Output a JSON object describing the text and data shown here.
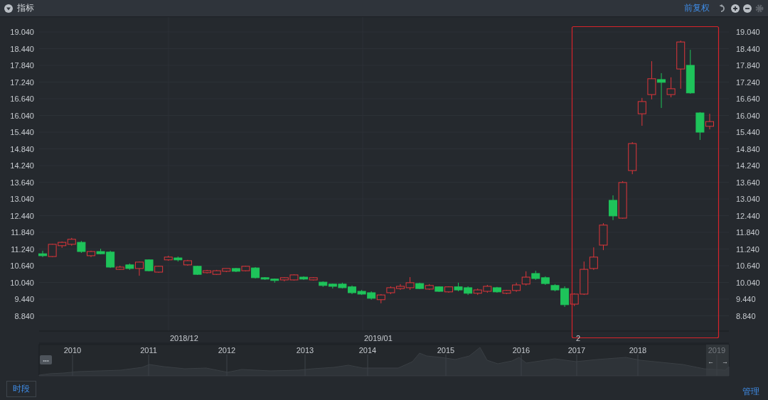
{
  "header": {
    "title": "指标",
    "adjust_link": "前复权"
  },
  "chart": {
    "right_ticks": [
      "19.040",
      "18.440",
      "17.840",
      "17.240",
      "16.640",
      "16.040",
      "15.440",
      "14.840",
      "14.240",
      "13.640",
      "13.040",
      "12.440",
      "11.840",
      "11.240",
      "10.640",
      "10.040",
      "9.440",
      "8.840"
    ],
    "x_labels": [
      "2018/12",
      "2019/01",
      "2"
    ],
    "chart_data": {
      "type": "candlestick",
      "grid": true,
      "ylim": [
        8.29,
        19.6
      ],
      "yticks": [
        {
          "value": 19.04,
          "label": "19.040"
        },
        {
          "value": 18.44,
          "label": "18.440"
        },
        {
          "value": 17.84,
          "label": "17.840"
        },
        {
          "value": 17.24,
          "label": "17.240"
        },
        {
          "value": 16.64,
          "label": "16.640"
        },
        {
          "value": 16.04,
          "label": "16.040"
        },
        {
          "value": 15.44,
          "label": "15.440"
        },
        {
          "value": 14.84,
          "label": "14.840"
        },
        {
          "value": 14.24,
          "label": "14.240"
        },
        {
          "value": 13.64,
          "label": "13.640"
        },
        {
          "value": 13.04,
          "label": "13.040"
        },
        {
          "value": 12.44,
          "label": "12.440"
        },
        {
          "value": 11.84,
          "label": "11.840"
        },
        {
          "value": 11.24,
          "label": "11.240"
        },
        {
          "value": 10.64,
          "label": "10.640"
        },
        {
          "value": 10.04,
          "label": "10.040"
        },
        {
          "value": 9.44,
          "label": "9.440"
        },
        {
          "value": 8.84,
          "label": "8.840"
        }
      ],
      "ohlc": [
        [
          11.07,
          11.18,
          10.95,
          11.0
        ],
        [
          10.97,
          11.43,
          10.95,
          11.41
        ],
        [
          11.36,
          11.51,
          11.28,
          11.48
        ],
        [
          11.41,
          11.64,
          11.36,
          11.59
        ],
        [
          11.48,
          11.53,
          11.1,
          11.15
        ],
        [
          11.0,
          11.18,
          10.95,
          11.15
        ],
        [
          11.15,
          11.25,
          11.05,
          11.07
        ],
        [
          11.13,
          11.18,
          10.56,
          10.59
        ],
        [
          10.51,
          10.64,
          10.49,
          10.59
        ],
        [
          10.67,
          10.72,
          10.49,
          10.54
        ],
        [
          10.54,
          10.79,
          10.28,
          10.77
        ],
        [
          10.85,
          10.87,
          10.44,
          10.46
        ],
        [
          10.41,
          10.64,
          10.39,
          10.62
        ],
        [
          10.85,
          11.0,
          10.82,
          10.95
        ],
        [
          10.92,
          10.97,
          10.79,
          10.85
        ],
        [
          10.67,
          10.85,
          10.64,
          10.82
        ],
        [
          10.62,
          10.64,
          10.31,
          10.33
        ],
        [
          10.39,
          10.49,
          10.36,
          10.46
        ],
        [
          10.33,
          10.49,
          10.31,
          10.46
        ],
        [
          10.44,
          10.54,
          10.41,
          10.54
        ],
        [
          10.54,
          10.56,
          10.41,
          10.44
        ],
        [
          10.46,
          10.64,
          10.44,
          10.62
        ],
        [
          10.56,
          10.59,
          10.18,
          10.21
        ],
        [
          10.21,
          10.23,
          10.13,
          10.16
        ],
        [
          10.16,
          10.18,
          10.03,
          10.11
        ],
        [
          10.13,
          10.23,
          10.08,
          10.21
        ],
        [
          10.13,
          10.33,
          10.11,
          10.31
        ],
        [
          10.23,
          10.26,
          10.13,
          10.16
        ],
        [
          10.13,
          10.23,
          10.11,
          10.21
        ],
        [
          10.05,
          10.08,
          9.88,
          9.93
        ],
        [
          9.98,
          10.0,
          9.82,
          9.9
        ],
        [
          9.98,
          10.03,
          9.82,
          9.85
        ],
        [
          9.88,
          9.93,
          9.62,
          9.67
        ],
        [
          9.72,
          9.77,
          9.59,
          9.62
        ],
        [
          9.67,
          9.72,
          9.42,
          9.47
        ],
        [
          9.42,
          9.62,
          9.29,
          9.59
        ],
        [
          9.67,
          9.9,
          9.62,
          9.85
        ],
        [
          9.82,
          9.98,
          9.77,
          9.9
        ],
        [
          9.85,
          10.23,
          9.77,
          10.03
        ],
        [
          10.0,
          10.03,
          9.8,
          9.82
        ],
        [
          9.8,
          9.98,
          9.77,
          9.93
        ],
        [
          9.88,
          9.9,
          9.7,
          9.72
        ],
        [
          9.7,
          9.9,
          9.67,
          9.88
        ],
        [
          9.88,
          10.03,
          9.72,
          9.77
        ],
        [
          9.85,
          9.9,
          9.59,
          9.65
        ],
        [
          9.65,
          9.82,
          9.59,
          9.77
        ],
        [
          9.72,
          9.95,
          9.67,
          9.9
        ],
        [
          9.85,
          9.88,
          9.67,
          9.7
        ],
        [
          9.65,
          9.77,
          9.62,
          9.75
        ],
        [
          9.75,
          10.03,
          9.7,
          9.95
        ],
        [
          9.98,
          10.44,
          9.93,
          10.23
        ],
        [
          10.36,
          10.46,
          10.13,
          10.18
        ],
        [
          10.21,
          10.26,
          9.95,
          10.0
        ],
        [
          9.93,
          9.98,
          9.72,
          9.77
        ],
        [
          9.82,
          9.9,
          9.16,
          9.24
        ],
        [
          9.26,
          9.65,
          9.19,
          9.62
        ],
        [
          9.62,
          10.79,
          9.59,
          10.51
        ],
        [
          10.54,
          11.3,
          10.49,
          10.95
        ],
        [
          11.38,
          12.17,
          11.2,
          12.1
        ],
        [
          12.99,
          13.17,
          12.28,
          12.43
        ],
        [
          12.35,
          13.68,
          12.33,
          13.63
        ],
        [
          14.06,
          15.08,
          13.93,
          15.03
        ],
        [
          16.1,
          16.67,
          15.67,
          16.54
        ],
        [
          16.79,
          17.99,
          16.62,
          17.36
        ],
        [
          17.33,
          17.56,
          16.31,
          17.23
        ],
        [
          16.79,
          17.41,
          16.69,
          17.0
        ],
        [
          17.71,
          18.73,
          17.0,
          18.68
        ],
        [
          17.84,
          18.4,
          16.82,
          16.85
        ],
        [
          16.13,
          16.16,
          15.16,
          15.44
        ],
        [
          15.65,
          16.1,
          15.54,
          15.82
        ]
      ]
    }
  },
  "navigator": {
    "years": [
      "2010",
      "2011",
      "2012",
      "2013",
      "2014",
      "2015",
      "2016",
      "2017",
      "2018",
      "2019"
    ],
    "handle_label": "•••",
    "arrows": [
      "←",
      "→"
    ]
  },
  "footer": {
    "period_button": "时段",
    "manage_link": "管理"
  }
}
